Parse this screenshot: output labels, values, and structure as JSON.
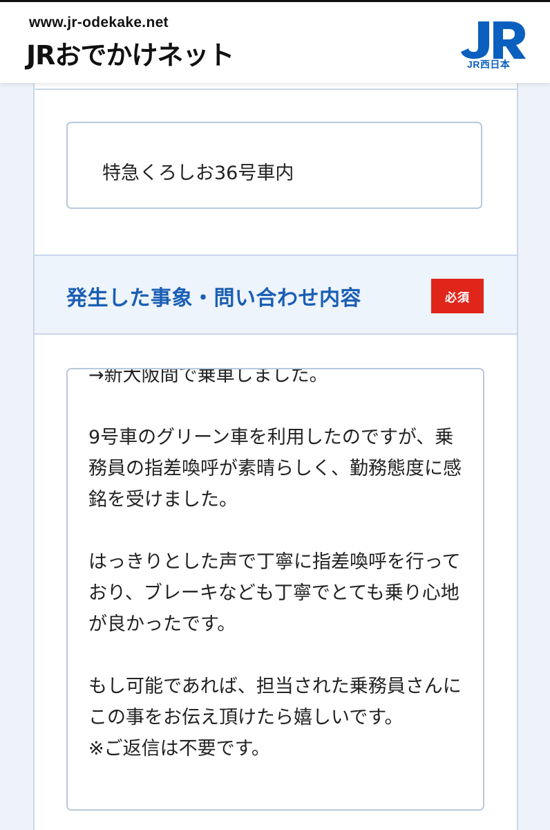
{
  "header": {
    "url_text": "www.jr-odekake.net",
    "site_logo_text": "JRおでかけネット",
    "company_logo_text": "JR",
    "company_caption": "JR西日本"
  },
  "form": {
    "location_value": "特急くろしお36号車内",
    "inquiry": {
      "label": "発生した事象・問い合わせ内容",
      "required_badge": "必須",
      "value": "→新大阪間で乗車しました。\n\n9号車のグリーン車を利用したのですが、乗務員の指差喚呼が素晴らしく、勤務態度に感銘を受けました。\n\nはっきりとした声で丁寧に指差喚呼を行っており、ブレーキなども丁寧でとても乗り心地が良かったです。\n\nもし可能であれば、担当された乗務員さんにこの事をお伝え頂けたら嬉しいです。\n※ご返信は不要です。"
    }
  },
  "colors": {
    "brand_blue": "#1a5fb4",
    "jrw_blue": "#0b5fbf",
    "required_red": "#e0261a",
    "field_border": "#b8c8de",
    "label_band_bg": "#eef4fc"
  },
  "icons": {
    "company_logo": "jr-west-logo"
  }
}
